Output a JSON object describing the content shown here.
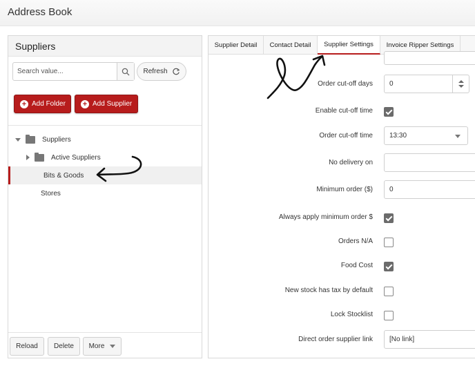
{
  "app": {
    "title": "Address Book"
  },
  "suppliers_panel": {
    "title": "Suppliers",
    "search": {
      "placeholder": "Search value...",
      "value": ""
    },
    "refresh_label": "Refresh",
    "add_folder_label": "Add Folder",
    "add_supplier_label": "Add Supplier",
    "tree": [
      {
        "label": "Suppliers",
        "level": 0,
        "expanded": true,
        "folder": true
      },
      {
        "label": "Active Suppliers",
        "level": 1,
        "expanded": false,
        "folder": true
      },
      {
        "label": "Bits & Goods",
        "level": 1,
        "selected": true,
        "folder": false
      },
      {
        "label": "Stores",
        "level": 0,
        "folder": false
      }
    ],
    "bottom_buttons": {
      "reload": "Reload",
      "delete": "Delete",
      "more": "More"
    }
  },
  "tabs": [
    {
      "label": "Supplier Detail",
      "active": false
    },
    {
      "label": "Contact Detail",
      "active": false
    },
    {
      "label": "Supplier Settings",
      "active": true
    },
    {
      "label": "Invoice Ripper Settings",
      "active": false
    }
  ],
  "settings": {
    "order_cutoff_days": {
      "label": "Order cut-off days",
      "value": "0"
    },
    "enable_cutoff_time": {
      "label": "Enable cut-off time",
      "checked": true
    },
    "order_cutoff_time": {
      "label": "Order cut-off time",
      "value": "13:30"
    },
    "no_delivery_on": {
      "label": "No delivery on",
      "value": ""
    },
    "minimum_order": {
      "label": "Minimum order ($)",
      "value": "0"
    },
    "always_apply_min": {
      "label": "Always apply minimum order $",
      "checked": true
    },
    "orders_na": {
      "label": "Orders N/A",
      "checked": false
    },
    "food_cost": {
      "label": "Food Cost",
      "checked": true
    },
    "new_stock_tax": {
      "label": "New stock has tax by default",
      "checked": false
    },
    "lock_stocklist": {
      "label": "Lock Stocklist",
      "checked": false
    },
    "direct_order_link": {
      "label": "Direct order supplier link",
      "value": "[No link]"
    }
  },
  "colors": {
    "accent": "#b71c1c",
    "checkbox_checked": "#6b6b6b"
  }
}
